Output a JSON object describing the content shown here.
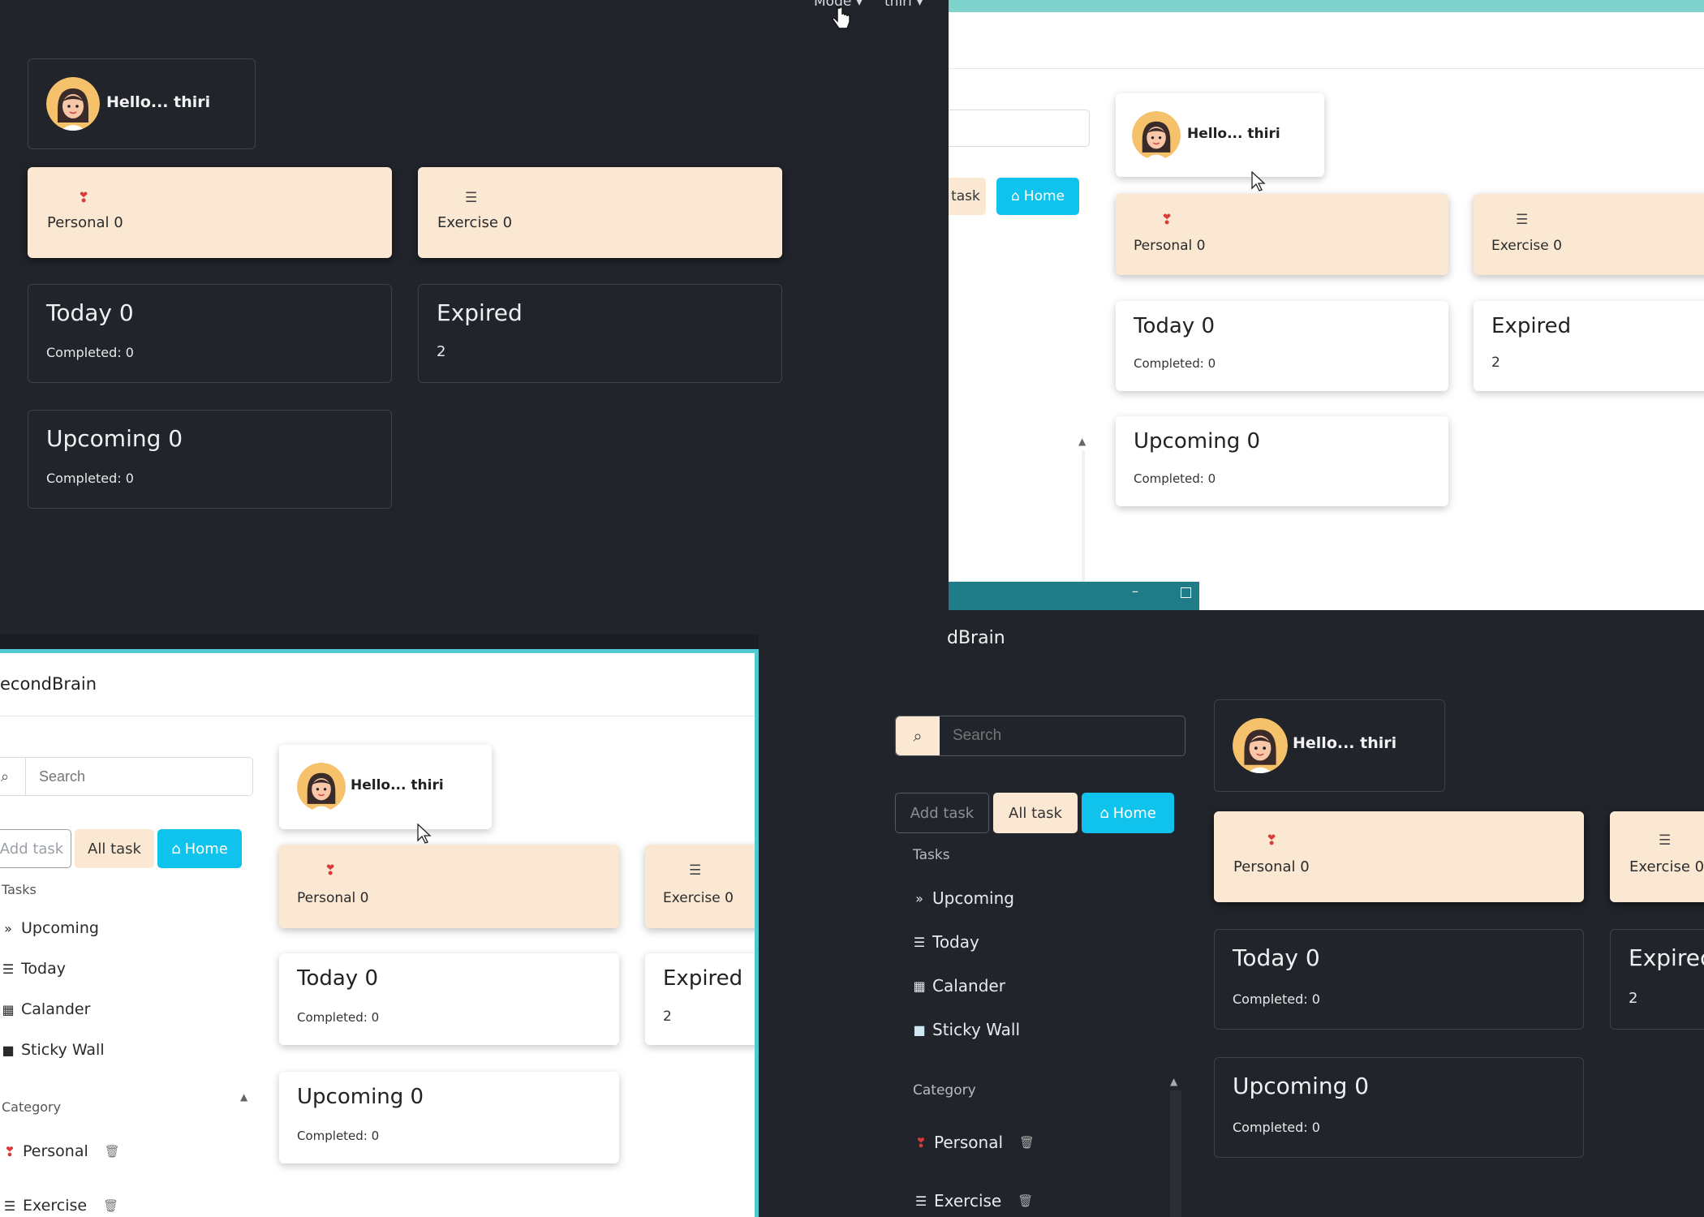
{
  "brand": "SecondBrain",
  "brand_tr": "econdBrain",
  "brand_br": "dBrain",
  "header": {
    "mode_label": "Mode",
    "user_label": "thiri"
  },
  "greeting": "Hello... thiri",
  "search": {
    "placeholder": "Search"
  },
  "buttons": {
    "add_task": "Add task",
    "add_task_partial": "task",
    "all_task": "All task",
    "home": "Home"
  },
  "nav": {
    "tasks_heading": "Tasks",
    "items": [
      "Upcoming",
      "Today",
      "Calander",
      "Sticky Wall"
    ],
    "category_heading": "Category",
    "categories": [
      "Personal",
      "Exercise"
    ]
  },
  "cards": {
    "personal": "Personal 0",
    "exercise": "Exercise 0",
    "exercise_cut": "Exercise 0",
    "today": "Today 0",
    "today_completed": "Completed: 0",
    "expired": "Expired",
    "expired_cut": "Expirec",
    "expired_count": "2",
    "upcoming": "Upcoming 0",
    "upcoming_completed": "Completed: 0"
  },
  "colors": {
    "dark_bg": "#21252b",
    "peach": "#fbe8d3",
    "home_button": "#10c3ec",
    "teal_border": "#4fc8cf",
    "heart": "#d93a3a"
  },
  "icons": [
    "heart-icon",
    "list-icon",
    "search-icon",
    "home-icon",
    "upcoming-icon",
    "today-list-icon",
    "calendar-icon",
    "sticky-note-icon",
    "trash-icon",
    "chevron-up-icon",
    "mouse-cursor"
  ]
}
